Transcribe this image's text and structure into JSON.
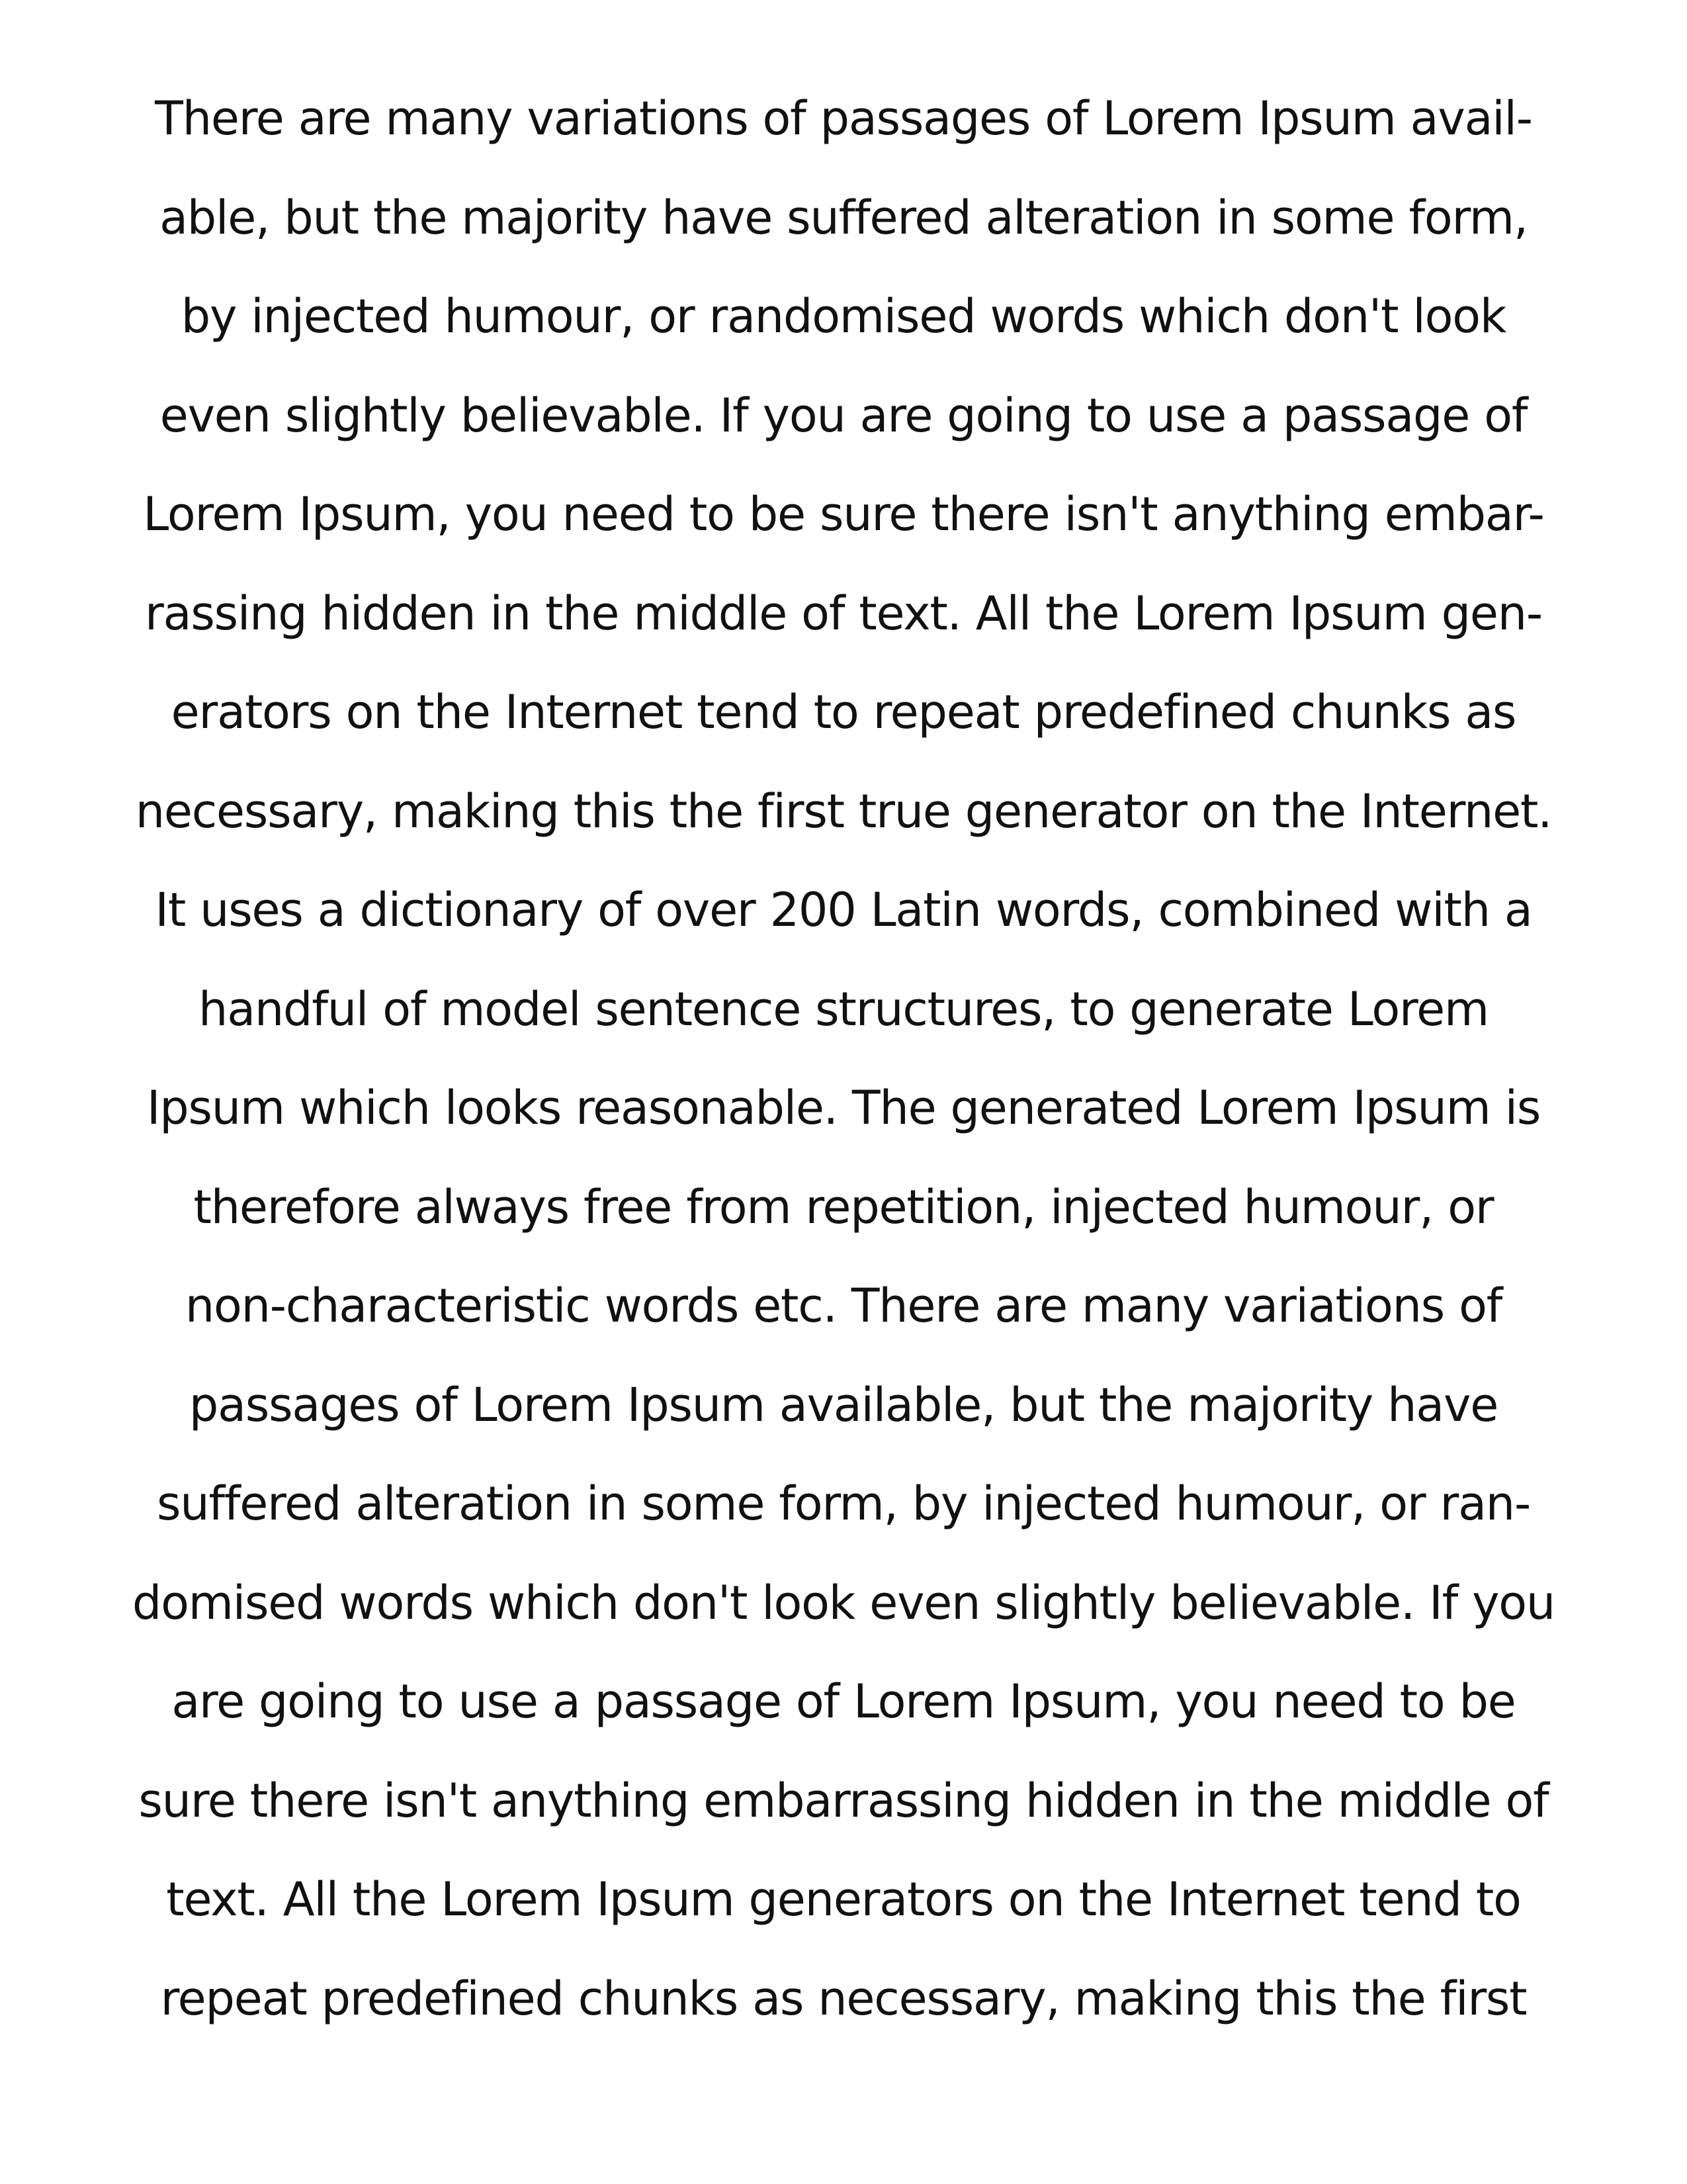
{
  "document": {
    "lines": [
      "There are many variations of passages of Lorem Ipsum avail-",
      "able, but the majority have suffered alteration in some form,",
      "by injected humour, or randomised words which don't look",
      "even slightly believable. If you are going to use a passage of",
      "Lorem Ipsum, you need to be sure there isn't anything embar-",
      "rassing hidden in the middle of text. All the Lorem Ipsum gen-",
      "erators on the Internet tend to repeat predefined chunks as",
      "necessary, making this the first true generator on the Internet.",
      "It uses a dictionary of over 200 Latin words, combined with a",
      "handful of model sentence structures, to generate Lorem",
      "Ipsum which looks reasonable. The generated Lorem Ipsum is",
      "therefore always free from repetition, injected humour, or",
      "non-characteristic words etc. There are many variations of",
      "passages of Lorem Ipsum available, but the majority have",
      "suffered alteration in some form, by injected humour, or ran-",
      "domised words which don't look even slightly believable. If you",
      "are going to use a passage of Lorem Ipsum, you need to be",
      "sure there isn't anything embarrassing hidden in the middle of",
      "text. All the Lorem Ipsum generators on the Internet tend to",
      "repeat predefined chunks as necessary, making this the first"
    ]
  }
}
